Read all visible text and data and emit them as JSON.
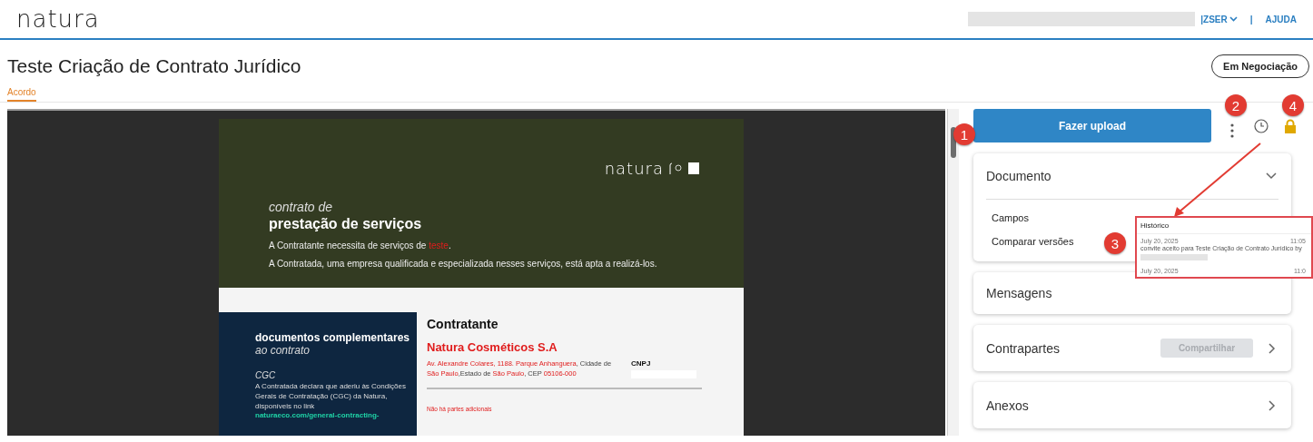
{
  "header": {
    "logo": "natura",
    "user_menu": "|ZSER",
    "separator": "|",
    "help_link": "AJUDA"
  },
  "page": {
    "title": "Teste Criação de Contrato Jurídico",
    "status": "Em Negociação"
  },
  "tabs": [
    {
      "label": "Acordo",
      "selected": true
    }
  ],
  "document": {
    "logo": "natura",
    "subtitle": "contrato de",
    "heading": "prestação de serviços",
    "intro_lines": [
      {
        "text": "A Contratante necessita de serviços de ",
        "highlight": "teste",
        "after": "."
      },
      {
        "text": "A Contratada, uma empresa qualificada e especializada nesses serviços, está apta a realizá-los."
      }
    ],
    "side_block": {
      "heading": "documentos complementares",
      "heading_italic": "ao contrato",
      "section": "CGC",
      "text": "A Contratada declara que aderiu às Condições Gerais de Contratação (CGC) da Natura, disponíveis no link",
      "link": "naturaeco.com/general-contracting-"
    },
    "party": {
      "heading": "Contratante",
      "name": "Natura Cosméticos S.A",
      "cnpj_label": "CNPJ",
      "no_parties": "Não há partes adicionais",
      "address": [
        {
          "text": "Av. Alexandre Colares, 1188.  Parque Anhanguera",
          "highlight": true
        },
        {
          "text": ", Cidade de ",
          "highlight": false
        },
        {
          "text": "São Paulo",
          "highlight": true
        },
        {
          "text": ",Estado de ",
          "highlight": false
        },
        {
          "text": "São Paulo",
          "highlight": true
        },
        {
          "text": ", CEP ",
          "highlight": false
        },
        {
          "text": "05106-000",
          "highlight": true
        }
      ]
    }
  },
  "actions": {
    "upload_button": "Fazer upload"
  },
  "panels": [
    {
      "kind": "expandable",
      "title": "Documento",
      "expanded": true,
      "items": [
        "Campos",
        "Comparar versões"
      ]
    },
    {
      "kind": "plain",
      "title": "Mensagens"
    },
    {
      "kind": "share",
      "title": "Contrapartes",
      "button": "Compartilhar",
      "button_disabled": true
    },
    {
      "kind": "link",
      "title": "Anexos"
    }
  ],
  "history_popup": {
    "title": "Histórico",
    "entries": [
      {
        "date": "July 20, 2025",
        "time": "11:05",
        "text": "convite aceito para Teste Criação de Contrato Jurídico by"
      },
      {
        "date": "July 20, 2025",
        "time": "11:0"
      }
    ]
  },
  "callouts": [
    "1",
    "2",
    "3",
    "4"
  ]
}
